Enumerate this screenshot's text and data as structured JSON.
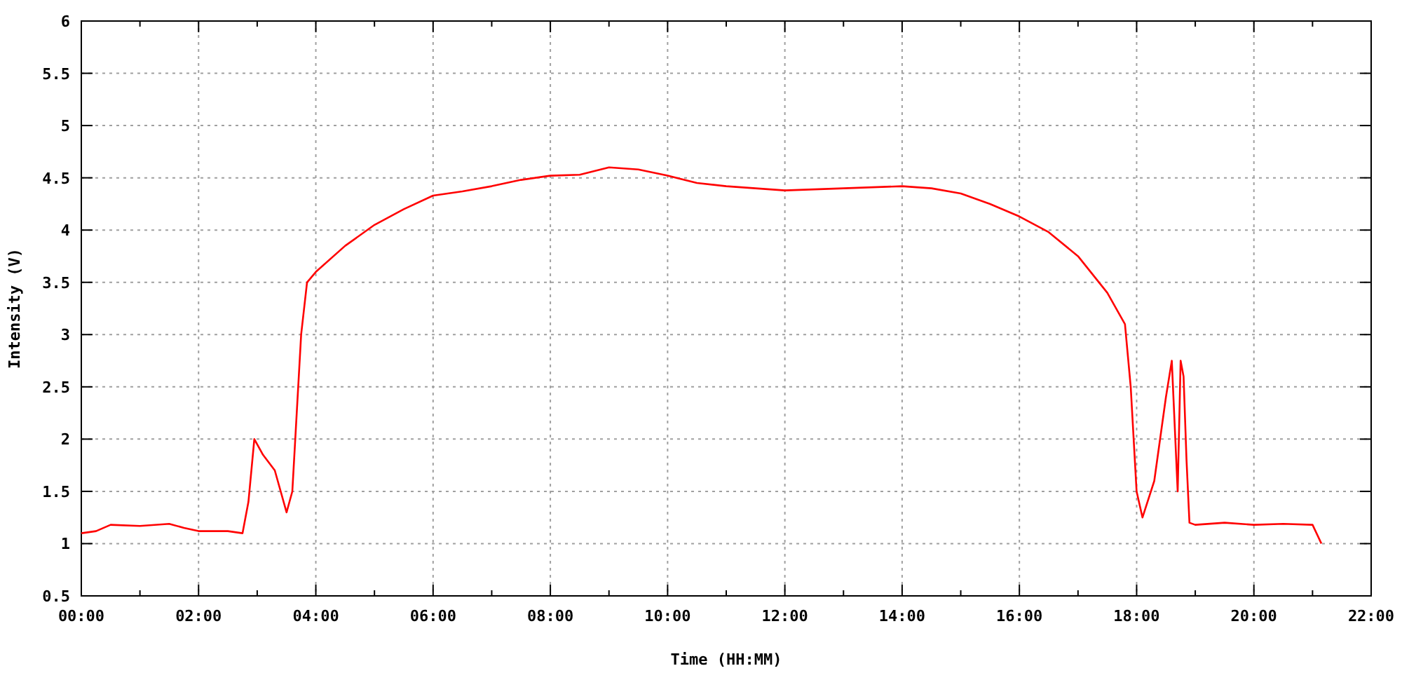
{
  "chart_data": {
    "type": "line",
    "grid": true,
    "xlabel": "Time (HH:MM)",
    "ylabel": "Intensity (V)",
    "xlim": [
      0,
      22
    ],
    "ylim": [
      0.5,
      6
    ],
    "xticks": [
      {
        "value": 0,
        "label": "00:00"
      },
      {
        "value": 2,
        "label": "02:00"
      },
      {
        "value": 4,
        "label": "04:00"
      },
      {
        "value": 6,
        "label": "06:00"
      },
      {
        "value": 8,
        "label": "08:00"
      },
      {
        "value": 10,
        "label": "10:00"
      },
      {
        "value": 12,
        "label": "12:00"
      },
      {
        "value": 14,
        "label": "14:00"
      },
      {
        "value": 16,
        "label": "16:00"
      },
      {
        "value": 18,
        "label": "18:00"
      },
      {
        "value": 20,
        "label": "20:00"
      },
      {
        "value": 22,
        "label": "22:00"
      }
    ],
    "yticks": [
      {
        "value": 0.5,
        "label": "0.5"
      },
      {
        "value": 1,
        "label": "1"
      },
      {
        "value": 1.5,
        "label": "1.5"
      },
      {
        "value": 2,
        "label": "2"
      },
      {
        "value": 2.5,
        "label": "2.5"
      },
      {
        "value": 3,
        "label": "3"
      },
      {
        "value": 3.5,
        "label": "3.5"
      },
      {
        "value": 4,
        "label": "4"
      },
      {
        "value": 4.5,
        "label": "4.5"
      },
      {
        "value": 5,
        "label": "5"
      },
      {
        "value": 5.5,
        "label": "5.5"
      },
      {
        "value": 6,
        "label": "6"
      }
    ],
    "x": [
      0,
      0.25,
      0.5,
      1,
      1.5,
      1.75,
      2,
      2.5,
      2.75,
      2.85,
      2.95,
      3.1,
      3.3,
      3.5,
      3.6,
      3.75,
      3.85,
      4,
      4.5,
      5,
      5.5,
      6,
      6.5,
      7,
      7.5,
      8,
      8.5,
      9,
      9.5,
      10,
      10.5,
      11,
      12,
      13,
      14,
      14.5,
      15,
      15.5,
      16,
      16.5,
      17,
      17.5,
      17.8,
      17.9,
      18,
      18.1,
      18.3,
      18.5,
      18.6,
      18.7,
      18.75,
      18.8,
      18.85,
      18.9,
      19,
      19.5,
      20,
      20.5,
      21,
      21.15
    ],
    "series": [
      {
        "color": "#ff0000",
        "values": [
          1.1,
          1.12,
          1.18,
          1.17,
          1.19,
          1.15,
          1.12,
          1.12,
          1.1,
          1.4,
          2.0,
          1.85,
          1.7,
          1.3,
          1.5,
          3.0,
          3.5,
          3.6,
          3.85,
          4.05,
          4.2,
          4.33,
          4.37,
          4.42,
          4.48,
          4.52,
          4.53,
          4.6,
          4.58,
          4.52,
          4.45,
          4.42,
          4.38,
          4.4,
          4.42,
          4.4,
          4.35,
          4.25,
          4.13,
          3.98,
          3.75,
          3.4,
          3.1,
          2.5,
          1.5,
          1.25,
          1.6,
          2.4,
          2.75,
          1.5,
          2.75,
          2.6,
          1.8,
          1.2,
          1.18,
          1.2,
          1.18,
          1.19,
          1.18,
          1.0
        ]
      }
    ]
  }
}
